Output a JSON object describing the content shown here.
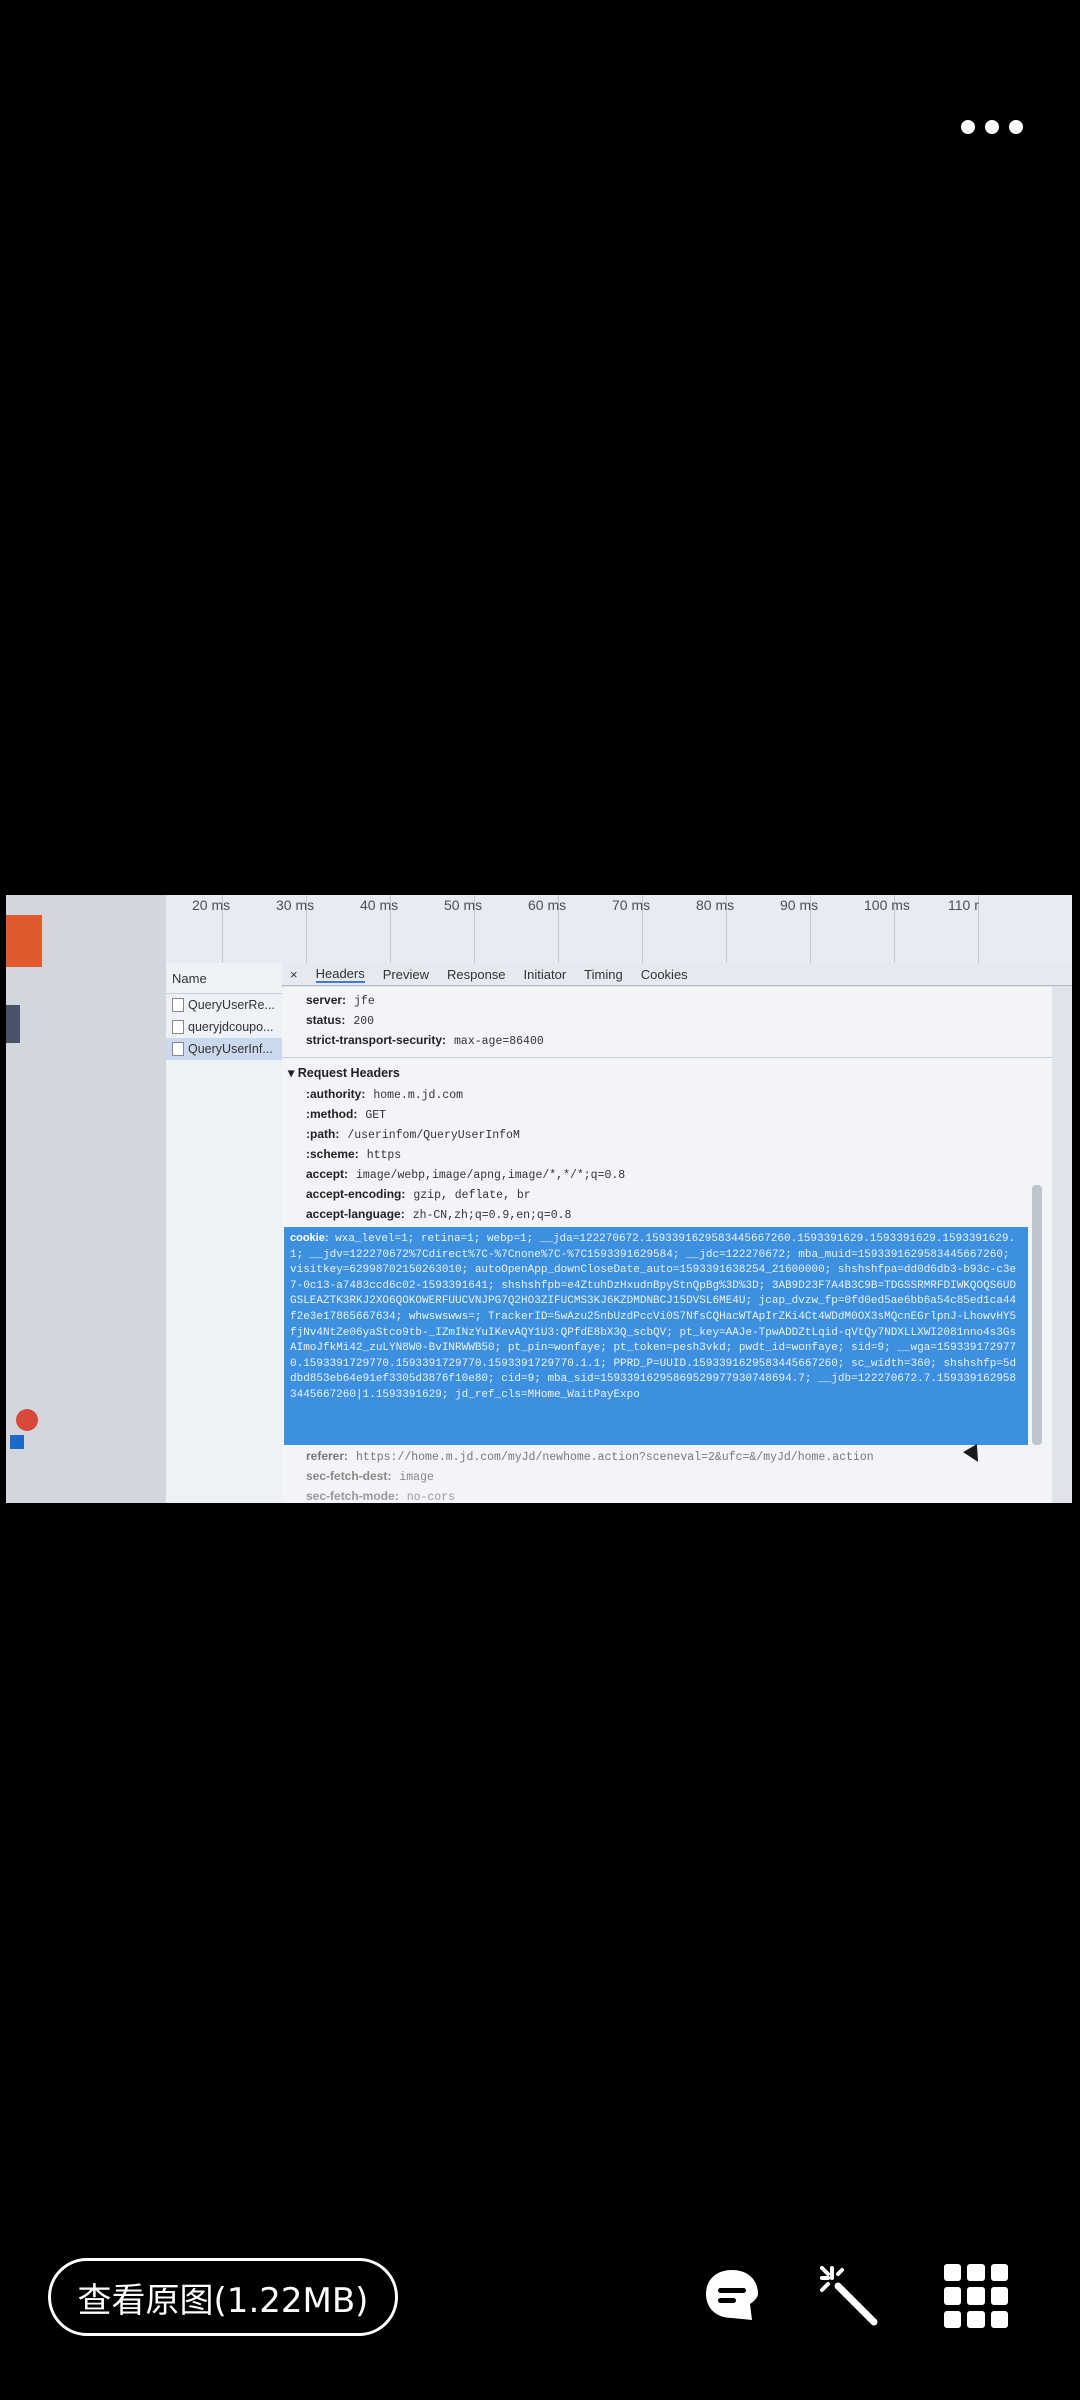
{
  "more_menu_icon": "more-horizontal-icon",
  "devtools": {
    "timeline_ticks": [
      "20 ms",
      "30 ms",
      "40 ms",
      "50 ms",
      "60 ms",
      "70 ms",
      "80 ms",
      "90 ms",
      "100 ms",
      "110 r"
    ],
    "name_header": "Name",
    "requests": [
      "QueryUserRe...",
      "queryjdcoupo...",
      "QueryUserInf..."
    ],
    "tabs": [
      "×",
      "Headers",
      "Preview",
      "Response",
      "Initiator",
      "Timing",
      "Cookies"
    ],
    "response_headers": [
      {
        "key": "server:",
        "value": "jfe"
      },
      {
        "key": "status:",
        "value": "200"
      },
      {
        "key": "strict-transport-security:",
        "value": "max-age=86400"
      }
    ],
    "request_headers_title": "▾ Request Headers",
    "request_headers": [
      {
        "key": ":authority:",
        "value": "home.m.jd.com"
      },
      {
        "key": ":method:",
        "value": "GET"
      },
      {
        "key": ":path:",
        "value": "/userinfom/QueryUserInfoM"
      },
      {
        "key": ":scheme:",
        "value": "https"
      },
      {
        "key": "accept:",
        "value": "image/webp,image/apng,image/*,*/*;q=0.8"
      },
      {
        "key": "accept-encoding:",
        "value": "gzip, deflate, br"
      },
      {
        "key": "accept-language:",
        "value": "zh-CN,zh;q=0.9,en;q=0.8"
      }
    ],
    "cookie_key": "cookie:",
    "cookie_value": "wxa_level=1; retina=1; webp=1; __jda=122270672.1593391629583445667260.1593391629.1593391629.1593391629.1; __jdv=122270672%7Cdirect%7C-%7Cnone%7C-%7C1593391629584; __jdc=122270672; mba_muid=1593391629583445667260; visitkey=62998702150263010; autoOpenApp_downCloseDate_auto=1593391638254_21600000; shshshfpa=dd0d6db3-b93c-c3e7-0c13-a7483ccd6c02-1593391641; shshshfpb=e4ZtuhDzHxudnBpyStnQpBg%3D%3D; 3AB9D23F7A4B3C9B=TDGSSRMRFDIWKQOQS6UDGSLEAZTK3RKJ2XO6QOKOWERFUUCVNJPG7Q2HO3ZIFUCMS3KJ6KZDMDNBCJ15DVSL6ME4U; jcap_dvzw_fp=0fd0ed5ae6bb6a54c85ed1ca44f2e3e17865667634; whwswswws=; TrackerID=5wAzu25nbUzdPccVi0S7NfsCQHacWTApIrZKi4Ct4WDdM0OX3sMQcnEGrlpnJ-LhowvHY5fjNv4NtZe06yaStco9tb-_IZmINzYuIKevAQY1U3:QPfdE8bX3Q_scbQV; pt_key=AAJe-TpwADDZtLqid-qVtQy7NDXLLXWI2081nno4s3GsAImoJfkMi42_zuLYN8W0-BvINRWWB50; pt_pin=wonfaye; pt_token=pesh3vkd; pwdt_id=wonfaye; sid=9; __wga=1593391729770.1593391729770.1593391729770.1593391729770.1.1; PPRD_P=UUID.1593391629583445667260; sc_width=360; shshshfp=5ddbd853eb64e91ef3305d3876f10e80; cid=9; mba_sid=15933916295869529977930748694.7; __jdb=122270672.7.1593391629583445667260|1.1593391629; jd_ref_cls=MHome_WaitPayExpo",
    "after_cookie": [
      {
        "key": "referer:",
        "value": "https://home.m.jd.com/myJd/newhome.action?sceneval=2&ufc=&/myJd/home.action"
      },
      {
        "key": "sec-fetch-dest:",
        "value": "image"
      },
      {
        "key": "sec-fetch-mode:",
        "value": "no-cors"
      }
    ]
  },
  "bottom_bar": {
    "view_original_label": "查看原图(1.22MB)",
    "icons": [
      "chat-bubble-icon",
      "magic-wand-icon",
      "grid-icon"
    ]
  }
}
